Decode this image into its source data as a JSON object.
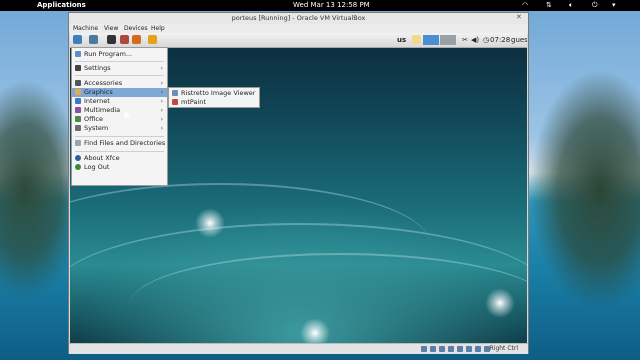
{
  "host": {
    "activities_label": "Applications",
    "clock": "Wed Mar 13 12:58 PM"
  },
  "window": {
    "title": "porteus [Running] - Oracle VM VirtualBox",
    "menu": [
      "Machine",
      "View",
      "Devices",
      "Help"
    ]
  },
  "guest_panel": {
    "keyboard_layout": "us",
    "time": "07:28",
    "user": "guest"
  },
  "menu": {
    "items": [
      {
        "label": "Run Program...",
        "icon": "run-icon"
      },
      {
        "label": "Settings",
        "icon": "settings-icon",
        "submenu": true
      },
      {
        "label": "Accessories",
        "icon": "accessories-icon",
        "submenu": true
      },
      {
        "label": "Graphics",
        "icon": "graphics-icon",
        "submenu": true,
        "highlighted": true
      },
      {
        "label": "Internet",
        "icon": "internet-icon",
        "submenu": true
      },
      {
        "label": "Multimedia",
        "icon": "multimedia-icon",
        "submenu": true
      },
      {
        "label": "Office",
        "icon": "office-icon",
        "submenu": true
      },
      {
        "label": "System",
        "icon": "system-icon",
        "submenu": true
      },
      {
        "label": "Find Files and Directories",
        "icon": "find-icon"
      },
      {
        "label": "About Xfce",
        "icon": "about-icon"
      },
      {
        "label": "Log Out",
        "icon": "logout-icon"
      }
    ],
    "submenu_graphics": [
      {
        "label": "Ristretto Image Viewer",
        "icon": "image-viewer-icon"
      },
      {
        "label": "mtPaint",
        "icon": "paint-icon"
      }
    ]
  },
  "status": {
    "host_key": "Right Ctrl"
  },
  "colors": {
    "highlight": "#7ea9d6",
    "host_bar": "#000000"
  }
}
